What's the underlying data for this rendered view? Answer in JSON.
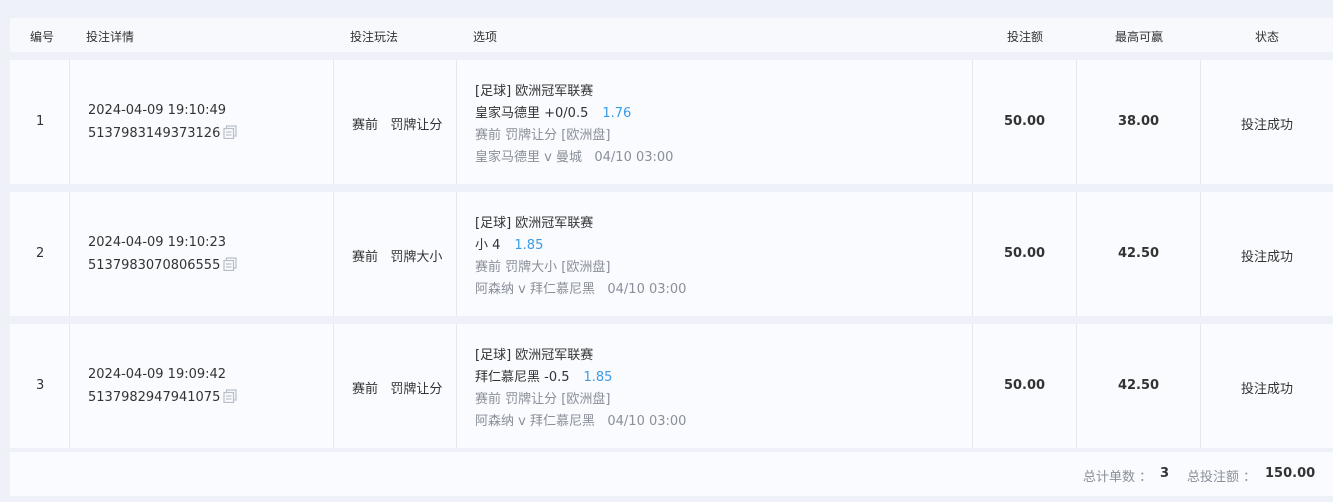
{
  "headers": {
    "no": "编号",
    "detail": "投注详情",
    "play": "投注玩法",
    "option": "选项",
    "amount": "投注额",
    "max_win": "最高可赢",
    "status": "状态"
  },
  "rows": [
    {
      "no": "1",
      "time": "2024-04-09 19:10:49",
      "order_id": "5137983149373126",
      "play_stage": "赛前",
      "play_type": "罚牌让分",
      "league": "[足球] 欧洲冠军联赛",
      "pick": "皇家马德里 +0/0.5",
      "odds": "1.76",
      "market": "赛前 罚牌让分 [欧洲盘]",
      "match": "皇家马德里 v 曼城",
      "match_time": "04/10 03:00",
      "amount": "50.00",
      "max_win": "38.00",
      "status": "投注成功"
    },
    {
      "no": "2",
      "time": "2024-04-09 19:10:23",
      "order_id": "5137983070806555",
      "play_stage": "赛前",
      "play_type": "罚牌大小",
      "league": "[足球] 欧洲冠军联赛",
      "pick": "小 4",
      "odds": "1.85",
      "market": "赛前 罚牌大小 [欧洲盘]",
      "match": "阿森纳 v 拜仁慕尼黑",
      "match_time": "04/10 03:00",
      "amount": "50.00",
      "max_win": "42.50",
      "status": "投注成功"
    },
    {
      "no": "3",
      "time": "2024-04-09 19:09:42",
      "order_id": "5137982947941075",
      "play_stage": "赛前",
      "play_type": "罚牌让分",
      "league": "[足球] 欧洲冠军联赛",
      "pick": "拜仁慕尼黑 -0.5",
      "odds": "1.85",
      "market": "赛前 罚牌让分 [欧洲盘]",
      "match": "阿森纳 v 拜仁慕尼黑",
      "match_time": "04/10 03:00",
      "amount": "50.00",
      "max_win": "42.50",
      "status": "投注成功"
    }
  ],
  "footer": {
    "count_label": "总计单数 ：",
    "count_value": "3",
    "total_label": "总投注额 ：",
    "total_value": "150.00"
  },
  "colors": {
    "accent_odds": "#3b9be6",
    "muted_text": "#8a8f99",
    "row_bg": "#f9fbff",
    "page_bg": "#eef2f8"
  },
  "icons": {
    "copy": "copy-icon"
  }
}
